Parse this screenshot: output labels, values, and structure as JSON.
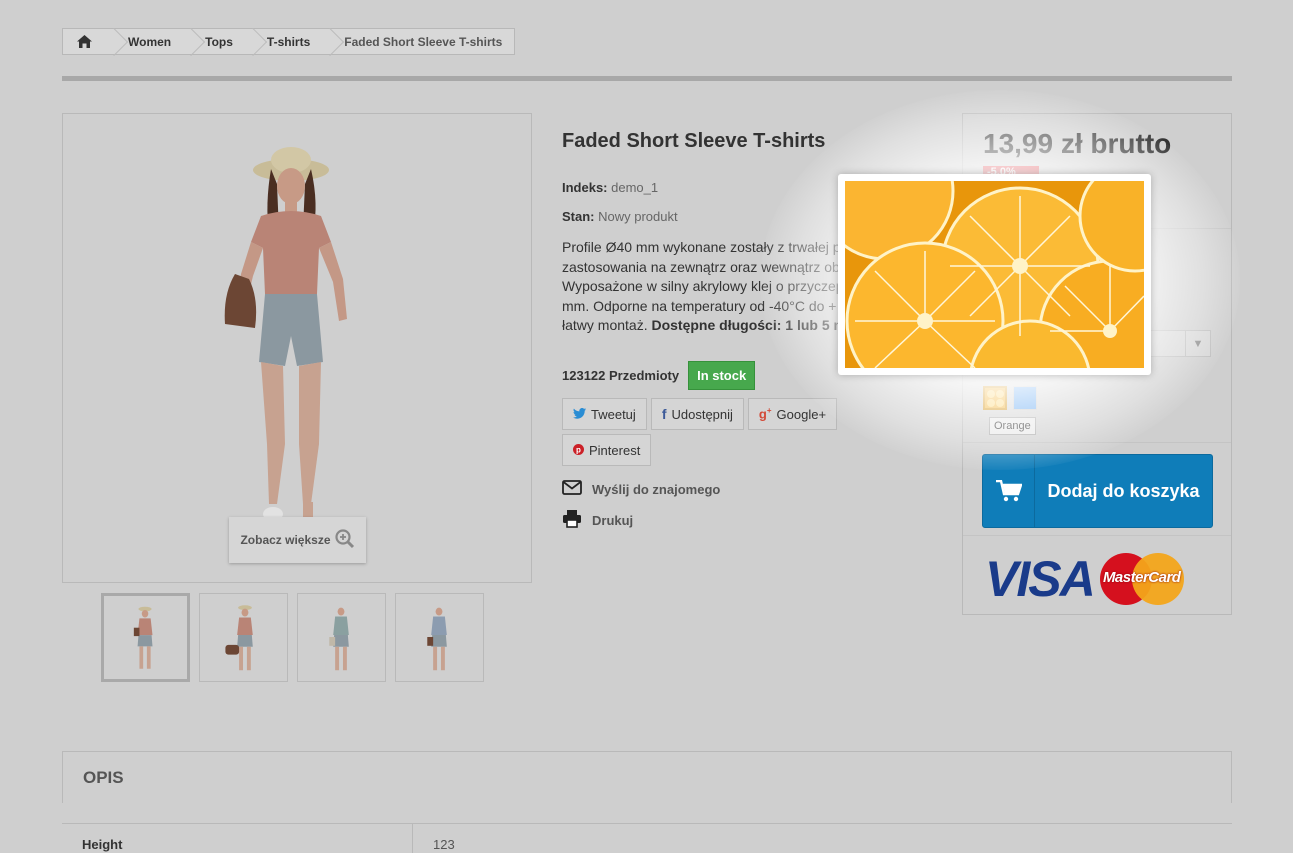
{
  "breadcrumb": {
    "items": [
      "Women",
      "Tops",
      "T-shirts"
    ],
    "current": "Faded Short Sleeve T-shirts"
  },
  "gallery": {
    "zoom_label": "Zobacz większe",
    "thumbnails": [
      "orange top pose 1",
      "orange top pose 2",
      "teal top",
      "blue top"
    ]
  },
  "product": {
    "title": "Faded Short Sleeve T-shirts",
    "reference_label": "Indeks:",
    "reference_value": "demo_1",
    "condition_label": "Stan:",
    "condition_value": "Nowy produkt",
    "description_lines": [
      "Profile Ø40 mm wykonane zostały z trwałej p",
      "zastosowania na zewnątrz oraz wewnątrz ob",
      "Wyposażone w silny akrylowy klej o przyczep",
      "mm. Odporne na temperatury od -40°C do +",
      "łatwy montaż. "
    ],
    "description_bold": "Dostępne długości: 1 lub 5 m",
    "quantity_text": "123122 Przedmioty",
    "stock_label": "In stock"
  },
  "social": {
    "tweet": "Tweetuj",
    "share": "Udostępnij",
    "google": "Google+",
    "pinterest": "Pinterest"
  },
  "links": {
    "send_friend": "Wyślij do znajomego",
    "print": "Drukuj"
  },
  "buy_box": {
    "price": "13,99 zł brutto",
    "discount": "-5,0%",
    "color_tooltip": "Orange",
    "add_to_cart": "Dodaj do koszyka",
    "payment_logos": [
      "VISA",
      "MasterCard"
    ]
  },
  "colors": {
    "swatch_orange": "#f2ab20",
    "swatch_blue": "#5ba3f0",
    "cart_button": "#0f7db9",
    "stock_badge": "#47a84d",
    "discount_badge": "#e13840"
  },
  "description_section": {
    "title": "OPIS"
  },
  "datasheet": {
    "name": "Height",
    "value": "123"
  }
}
